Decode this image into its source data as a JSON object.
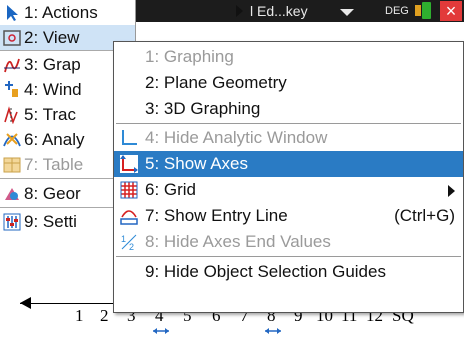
{
  "topbar": {
    "doc_title": "l Ed...key",
    "angle_mode": "DEG",
    "close_glyph": "×"
  },
  "left_menu": {
    "items": [
      {
        "label": "1: Actions"
      },
      {
        "label": "2: View"
      },
      {
        "label": "3: Grap"
      },
      {
        "label": "4: Wind"
      },
      {
        "label": "5: Trac"
      },
      {
        "label": "6: Analy"
      },
      {
        "label": "7: Table"
      },
      {
        "label": "8: Geor"
      },
      {
        "label": "9: Setti"
      }
    ]
  },
  "submenu": {
    "items": [
      {
        "label": "1: Graphing"
      },
      {
        "label": "2: Plane Geometry"
      },
      {
        "label": "3: 3D Graphing"
      },
      {
        "label": "4: Hide Analytic Window"
      },
      {
        "label": "5: Show Axes"
      },
      {
        "label": "6: Grid"
      },
      {
        "label": "7: Show Entry Line",
        "shortcut": "(Ctrl+G)"
      },
      {
        "label": "8: Hide Axes End Values"
      },
      {
        "label": "9: Hide Object Selection Guides"
      }
    ]
  },
  "axis": {
    "tick_labels": [
      "1",
      "2",
      "3",
      "4",
      "5",
      "6",
      "7",
      "8",
      "9",
      "10",
      "11",
      "12",
      "SQ"
    ]
  },
  "colors": {
    "selection": "#2a7bc4",
    "active_menu": "#cfe3f6",
    "close": "#e23a3a"
  }
}
